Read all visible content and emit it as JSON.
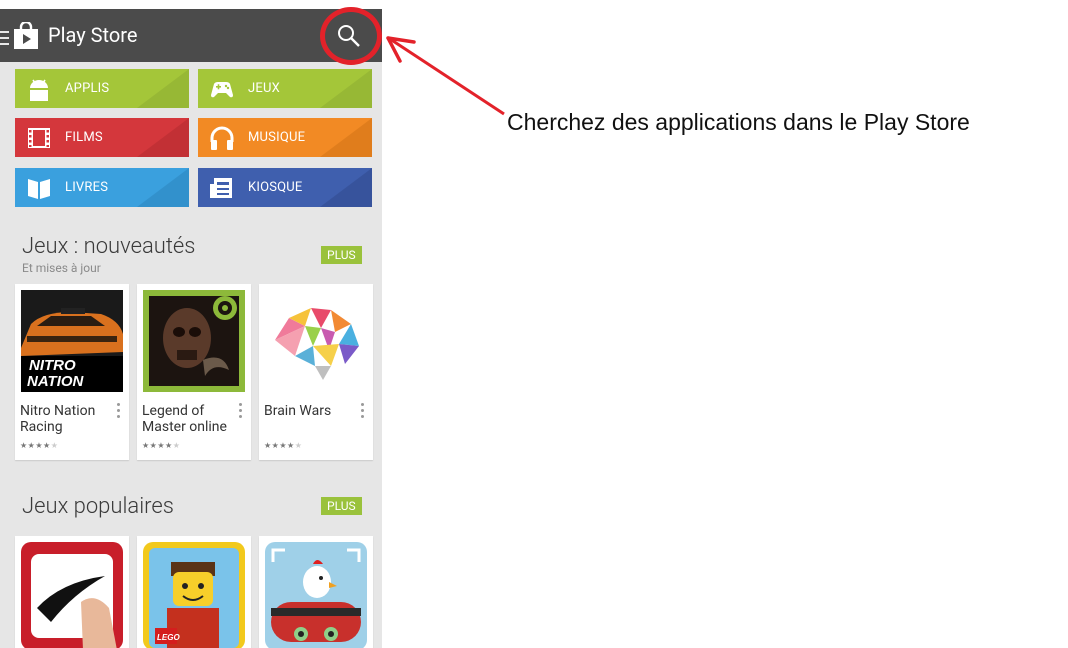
{
  "app": {
    "title": "Play Store"
  },
  "categories": [
    {
      "label": "APPLIS",
      "color": "#a4c639",
      "dark": "#97b835",
      "icon": "android-icon"
    },
    {
      "label": "JEUX",
      "color": "#a4c639",
      "dark": "#97b835",
      "icon": "gamepad-icon"
    },
    {
      "label": "FILMS",
      "color": "#d4373c",
      "dark": "#c23035",
      "icon": "film-icon"
    },
    {
      "label": "MUSIQUE",
      "color": "#f28a24",
      "dark": "#e07d1c",
      "icon": "headphones-icon"
    },
    {
      "label": "LIVRES",
      "color": "#3aa0de",
      "dark": "#3291cc",
      "icon": "book-icon"
    },
    {
      "label": "KIOSQUE",
      "color": "#3f5fae",
      "dark": "#37539c",
      "icon": "newsstand-icon"
    }
  ],
  "section_new": {
    "title": "Jeux : nouveautés",
    "subtitle": "Et mises à jour",
    "more_label": "PLUS",
    "apps": [
      {
        "name": "Nitro Nation Racing",
        "rating": 4
      },
      {
        "name": "Legend of Master online",
        "rating": 4
      },
      {
        "name": "Brain Wars",
        "rating": 4
      }
    ]
  },
  "section_popular": {
    "title": "Jeux populaires",
    "more_label": "PLUS"
  },
  "annotation": {
    "text": "Cherchez des applications dans le Play Store",
    "color": "#e3222a"
  }
}
